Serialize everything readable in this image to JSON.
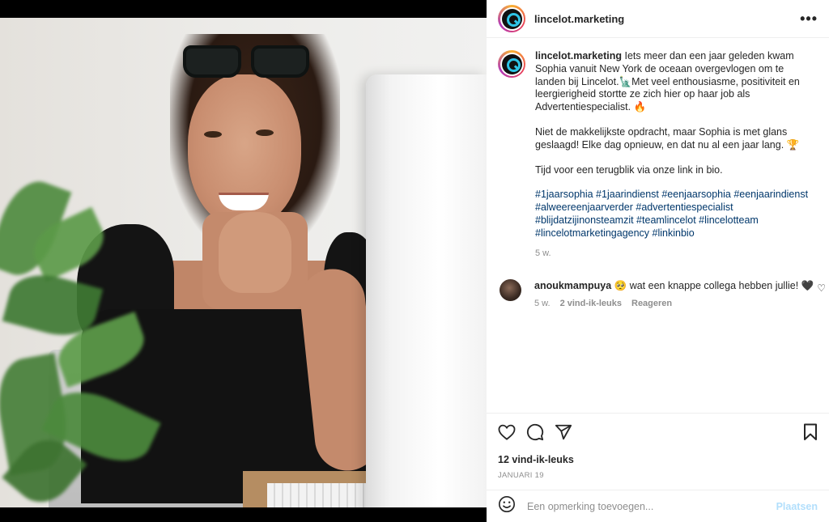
{
  "post": {
    "username": "lincelot.marketing",
    "more_icon": "more-horizontal-icon"
  },
  "caption": {
    "username": "lincelot.marketing",
    "paragraph1": "Iets meer dan een jaar geleden kwam Sophia vanuit New York de oceaan overgevlogen om te landen bij Lincelot.🗽Met veel enthousiasme, positiviteit en leergierigheid stortte ze zich hier op haar job als Advertentiespecialist. 🔥",
    "paragraph2": "Niet de makkelijkste opdracht, maar Sophia is met glans geslaagd! Elke dag opnieuw, en dat nu al een jaar lang. 🏆",
    "paragraph3": "Tijd voor een terugblik via onze link in bio.",
    "hashtags": "#1jaarsophia #1jaarindienst #eenjaarsophia #eenjaarindienst #alweereenjaarverder #advertentiespecialist #blijdatzijinonsteamzit #teamlincelot #lincelotteam #lincelotmarketingagency #linkinbio",
    "age": "5 w."
  },
  "comment": {
    "username": "anoukmampuya",
    "text": "🥺 wat een knappe collega hebben jullie! 🖤",
    "age": "5 w.",
    "likes": "2 vind-ik-leuks",
    "reply": "Reageren"
  },
  "actions": {
    "likes": "12 vind-ik-leuks",
    "date": "JANUARI 19"
  },
  "add_comment": {
    "placeholder": "Een opmerking toevoegen...",
    "post_label": "Plaatsen"
  },
  "colors": {
    "link": "#00376b",
    "muted": "#8e8e8e",
    "post_disabled": "#b2dffc"
  }
}
